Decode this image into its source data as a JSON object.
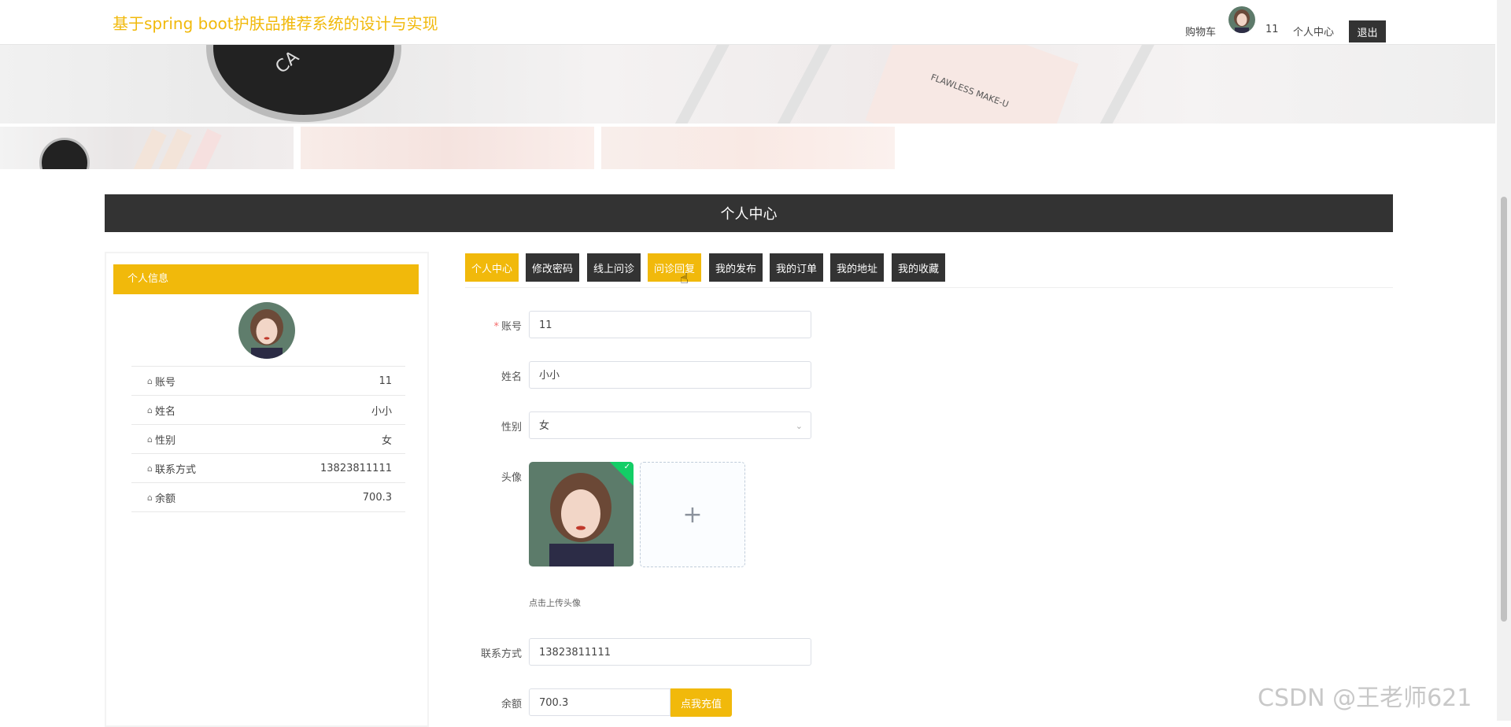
{
  "header": {
    "site_title": "基于spring boot护肤品推荐系统的设计与实现",
    "cart_label": "购物车",
    "username": "11",
    "profile_label": "个人中心",
    "logout_label": "退出"
  },
  "banner": {
    "jar_text": "CA",
    "tube_text": "FLAWLESS MAKE-U"
  },
  "section": {
    "title": "个人中心"
  },
  "left_panel": {
    "title": "个人信息",
    "rows": [
      {
        "label": "账号",
        "value": "11"
      },
      {
        "label": "姓名",
        "value": "小小"
      },
      {
        "label": "性别",
        "value": "女"
      },
      {
        "label": "联系方式",
        "value": "13823811111"
      },
      {
        "label": "余额",
        "value": "700.3"
      }
    ]
  },
  "tabs": [
    {
      "label": "个人中心",
      "active": true
    },
    {
      "label": "修改密码",
      "active": false
    },
    {
      "label": "线上问诊",
      "active": false
    },
    {
      "label": "问诊回复",
      "active": true
    },
    {
      "label": "我的发布",
      "active": false
    },
    {
      "label": "我的订单",
      "active": false
    },
    {
      "label": "我的地址",
      "active": false
    },
    {
      "label": "我的收藏",
      "active": false
    }
  ],
  "form": {
    "account_label": "账号",
    "account_value": "11",
    "name_label": "姓名",
    "name_value": "小小",
    "gender_label": "性别",
    "gender_value": "女",
    "avatar_label": "头像",
    "avatar_tip": "点击上传头像",
    "upload_plus": "+",
    "phone_label": "联系方式",
    "phone_value": "13823811111",
    "balance_label": "余额",
    "balance_value": "700.3",
    "recharge_label": "点我充值"
  },
  "icons": {
    "home": "⌂",
    "chevron": "⌄",
    "check": "✓",
    "cursor": "☝"
  },
  "colors": {
    "accent": "#f1b90b",
    "dark": "#333333",
    "success": "#13ce66"
  },
  "watermark": "CSDN @王老师621"
}
